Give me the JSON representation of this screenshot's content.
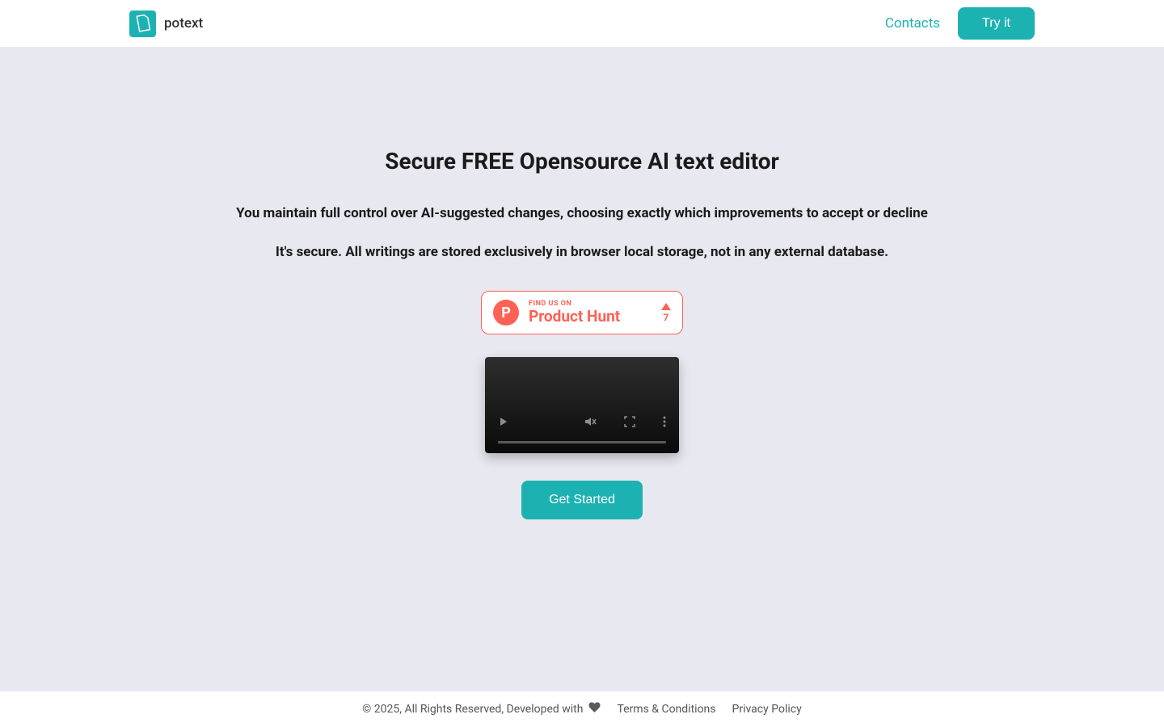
{
  "header": {
    "brand": "potext",
    "contacts_label": "Contacts",
    "try_label": "Try it"
  },
  "hero": {
    "title": "Secure FREE Opensource AI text editor",
    "subtitle1": "You maintain full control over AI-suggested changes, choosing exactly which improvements to accept or decline",
    "subtitle2": "It's secure. All writings are stored exclusively in browser local storage, not in any external database."
  },
  "product_hunt": {
    "small_label": "FIND US ON",
    "big_label": "Product Hunt",
    "letter": "P",
    "votes": "7"
  },
  "cta": {
    "get_started": "Get Started"
  },
  "footer": {
    "copyright": "© 2025, All Rights Reserved, Developed with",
    "terms": "Terms & Conditions",
    "privacy": "Privacy Policy"
  },
  "colors": {
    "accent": "#1db2b2",
    "product_hunt": "#ff6154",
    "page_bg": "#e8e8f0"
  }
}
